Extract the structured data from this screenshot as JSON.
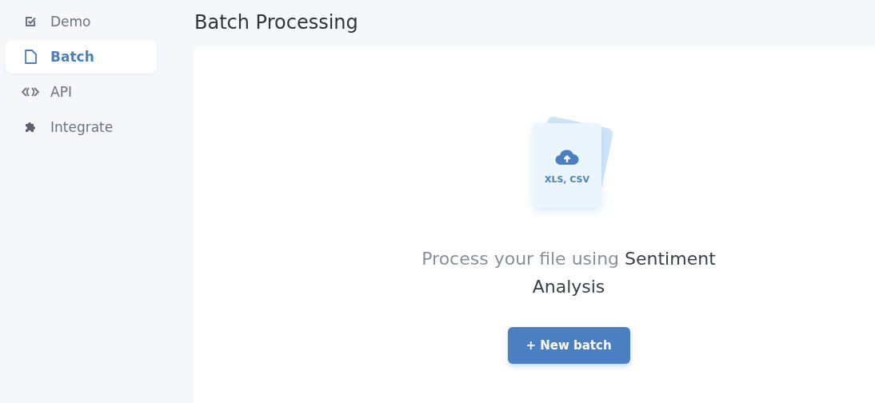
{
  "sidebar": {
    "items": [
      {
        "label": "Demo",
        "selected": false
      },
      {
        "label": "Batch",
        "selected": true
      },
      {
        "label": "API",
        "selected": false
      },
      {
        "label": "Integrate",
        "selected": false
      }
    ]
  },
  "page": {
    "title": "Batch Processing"
  },
  "upload": {
    "formats": "XLS, CSV",
    "message": "Process your file using",
    "message_emphasis": "Sentiment Analysis",
    "button": "+ New batch"
  }
}
